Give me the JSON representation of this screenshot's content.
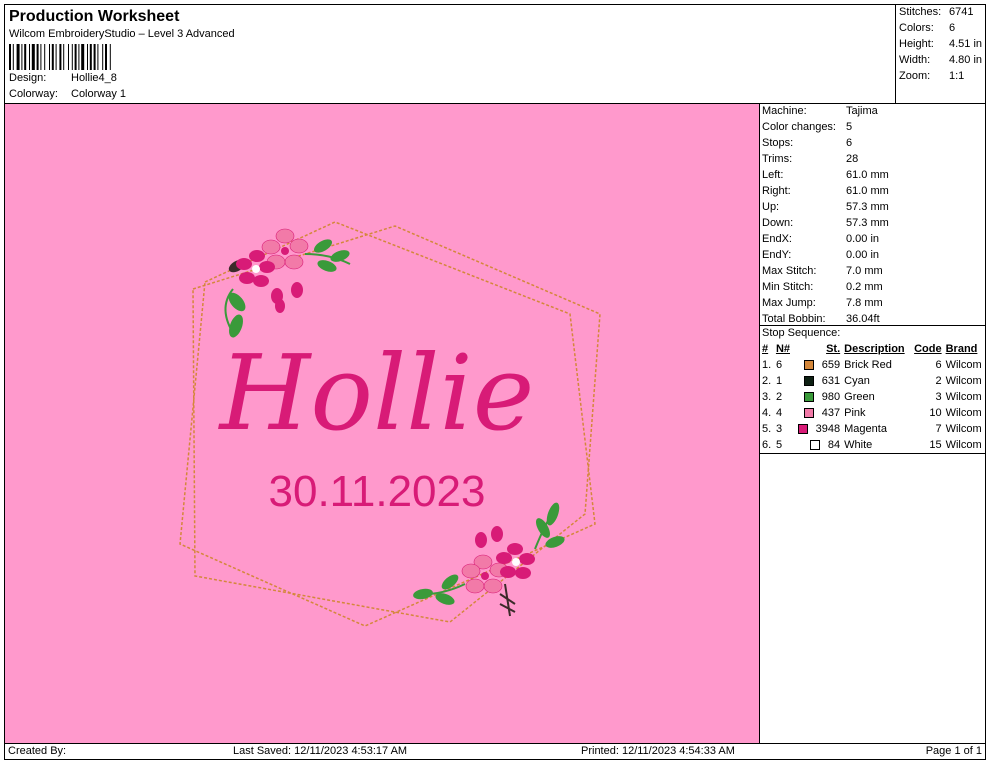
{
  "header": {
    "title": "Production Worksheet",
    "software": "Wilcom EmbroideryStudio – Level 3 Advanced",
    "design_label": "Design:",
    "design_value": "Hollie4_8",
    "colorway_label": "Colorway:",
    "colorway_value": "Colorway 1"
  },
  "summary": {
    "stitches_label": "Stitches:",
    "stitches_value": "6741",
    "colors_label": "Colors:",
    "colors_value": "6",
    "height_label": "Height:",
    "height_value": "4.51 in",
    "width_label": "Width:",
    "width_value": "4.80 in",
    "zoom_label": "Zoom:",
    "zoom_value": "1:1"
  },
  "design_info": {
    "machine_label": "Machine:",
    "machine_value": "Tajima",
    "color_changes_label": "Color changes:",
    "color_changes_value": "5",
    "stops_label": "Stops:",
    "stops_value": "6",
    "trims_label": "Trims:",
    "trims_value": "28",
    "left_label": "Left:",
    "left_value": "61.0 mm",
    "right_label": "Right:",
    "right_value": "61.0 mm",
    "up_label": "Up:",
    "up_value": "57.3 mm",
    "down_label": "Down:",
    "down_value": "57.3 mm",
    "endx_label": "EndX:",
    "endx_value": "0.00 in",
    "endy_label": "EndY:",
    "endy_value": "0.00 in",
    "max_stitch_label": "Max Stitch:",
    "max_stitch_value": "7.0 mm",
    "min_stitch_label": "Min Stitch:",
    "min_stitch_value": "0.2 mm",
    "max_jump_label": "Max Jump:",
    "max_jump_value": "7.8 mm",
    "total_bobbin_label": "Total Bobbin:",
    "total_bobbin_value": "36.04ft"
  },
  "stop_sequence": {
    "heading": "Stop Sequence:",
    "columns": [
      "#",
      "N#",
      "St.",
      "Description",
      "Code",
      "Brand"
    ],
    "rows": [
      {
        "idx": "1.",
        "n": "6",
        "color": "#d4873a",
        "st": "659",
        "desc": "Brick Red",
        "code": "6",
        "brand": "Wilcom"
      },
      {
        "idx": "2.",
        "n": "1",
        "color": "#0d1f12",
        "st": "631",
        "desc": "Cyan",
        "code": "2",
        "brand": "Wilcom"
      },
      {
        "idx": "3.",
        "n": "2",
        "color": "#3a9a3a",
        "st": "980",
        "desc": "Green",
        "code": "3",
        "brand": "Wilcom"
      },
      {
        "idx": "4.",
        "n": "4",
        "color": "#f27aa8",
        "st": "437",
        "desc": "Pink",
        "code": "10",
        "brand": "Wilcom"
      },
      {
        "idx": "5.",
        "n": "3",
        "color": "#d81b77",
        "st": "3948",
        "desc": "Magenta",
        "code": "7",
        "brand": "Wilcom"
      },
      {
        "idx": "6.",
        "n": "5",
        "color": "#ffffff",
        "st": "84",
        "desc": "White",
        "code": "15",
        "brand": "Wilcom"
      }
    ]
  },
  "preview": {
    "background": "#ff99cc",
    "name_text": "Hollie",
    "date_text": "30.11.2023",
    "text_color": "#d81b77",
    "frame_color": "#d4873a"
  },
  "footer": {
    "created_by": "Created By:",
    "last_saved": "Last Saved: 12/11/2023 4:53:17 AM",
    "printed": "Printed: 12/11/2023 4:54:33 AM",
    "page": "Page 1 of 1"
  }
}
